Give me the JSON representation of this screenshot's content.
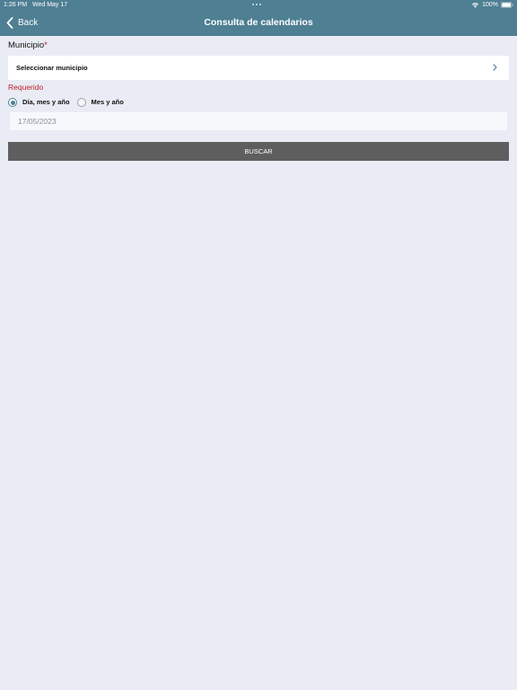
{
  "status_bar": {
    "time": "1:26 PM",
    "date": "Wed May 17",
    "battery": "100%"
  },
  "nav": {
    "back_label": "Back",
    "title": "Consulta de calendarios"
  },
  "form": {
    "municipio_label": "Municipio",
    "required_star": "*",
    "municipio_placeholder": "Seleccionar municipio",
    "required_message": "Requerido",
    "radio_options": [
      {
        "label": "Día, mes y año",
        "selected": true
      },
      {
        "label": "Mes y año",
        "selected": false
      }
    ],
    "date_value": "17/05/2023",
    "search_label": "BUSCAR"
  },
  "icons": {
    "back": "chevron-left-icon",
    "select_arrow": "chevron-right-icon",
    "wifi": "wifi-icon",
    "battery": "battery-icon"
  },
  "colors": {
    "header": "#4e7f93",
    "background": "#e9ecf4",
    "required": "#c0202b",
    "button": "#5e5e5e",
    "accent": "#4e7f93"
  }
}
